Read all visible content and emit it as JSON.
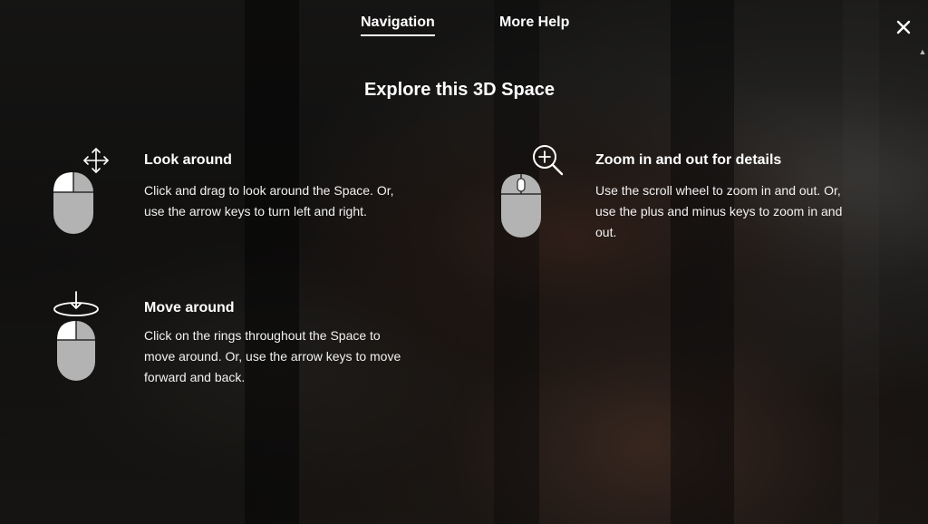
{
  "tabs": {
    "navigation": "Navigation",
    "more_help": "More Help"
  },
  "close_icon": "close-icon",
  "heading": "Explore this 3D Space",
  "items": [
    {
      "title": "Look around",
      "text_line1": "Click and drag to look around the Space. Or,",
      "text_line2": "use the arrow keys to turn left and right.",
      "icon": "mouse-drag-look-icon"
    },
    {
      "title": "Zoom in and out for details",
      "text_line1": "Use the scroll wheel to zoom in and out. Or,",
      "text_line2": "use the plus and minus keys to zoom in and",
      "text_line3": "out.",
      "icon": "mouse-scroll-zoom-icon"
    },
    {
      "title": "Move around",
      "text_line1": "Click on the rings throughout the Space to",
      "text_line2": "move around. Or, use the arrow keys to move",
      "text_line3": "forward and back.",
      "icon": "mouse-click-move-icon"
    }
  ],
  "colors": {
    "text": "#ffffff",
    "mouse_body": "#b5b5b5",
    "overlay": "#000000"
  }
}
